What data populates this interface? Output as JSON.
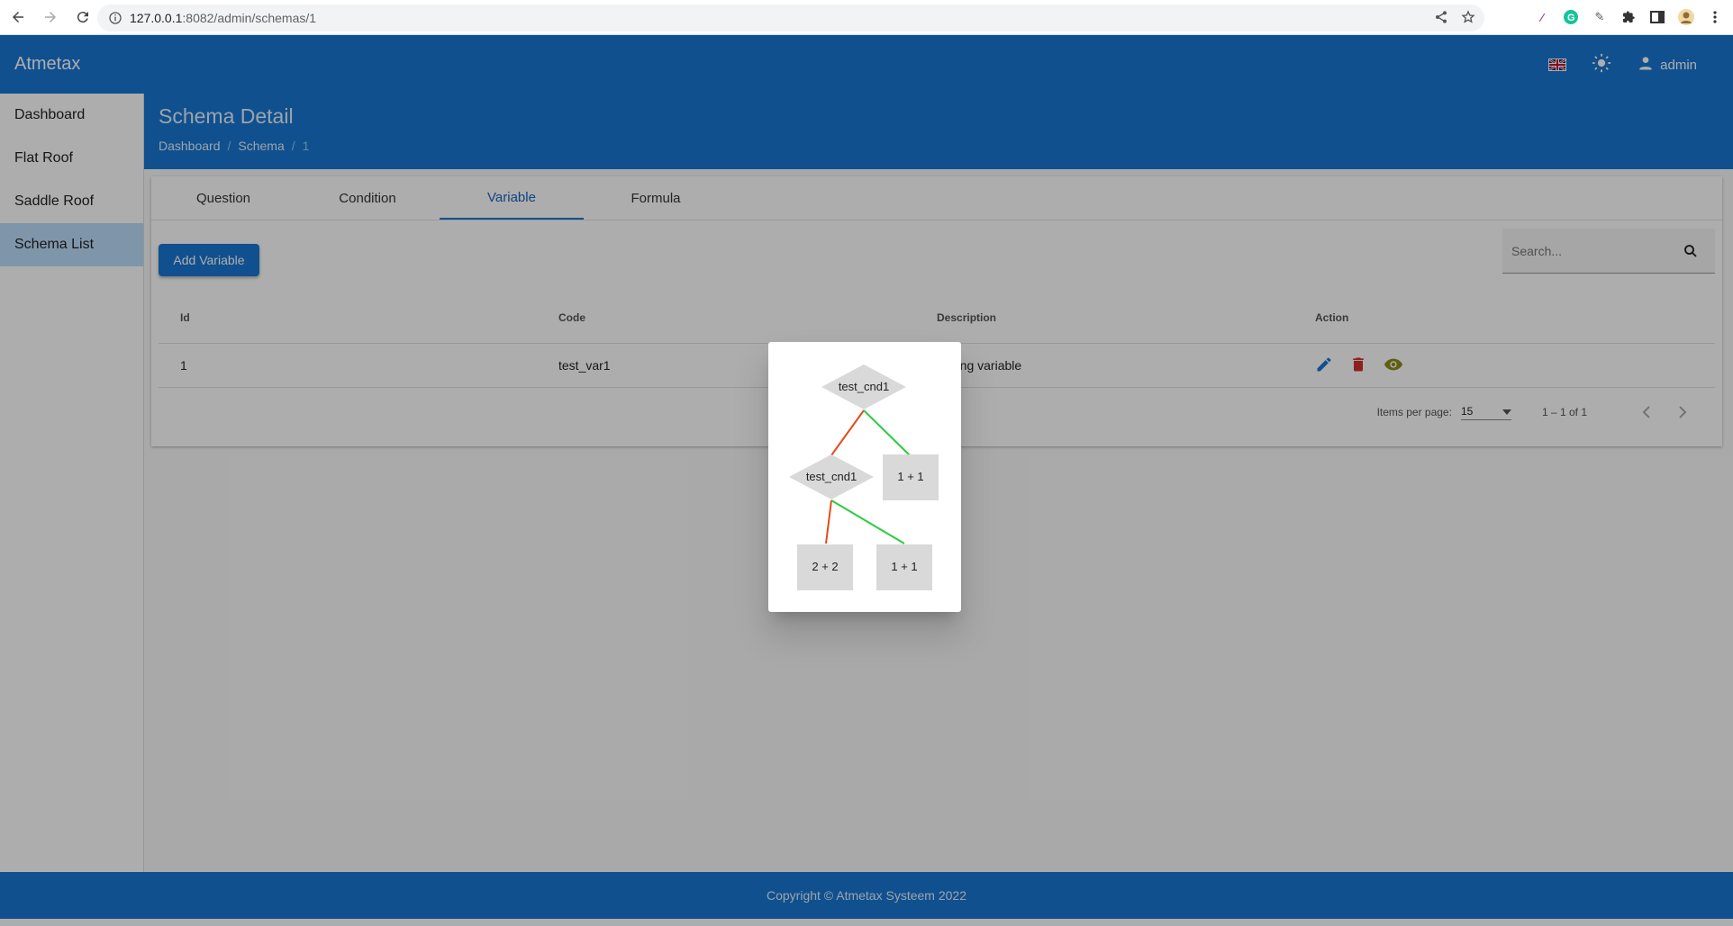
{
  "browser": {
    "url_host": "127.0.0.1",
    "url_path": ":8082/admin/schemas/1"
  },
  "app": {
    "brand": "Atmetax",
    "user": "admin"
  },
  "sidebar": {
    "items": [
      {
        "label": "Dashboard"
      },
      {
        "label": "Flat Roof"
      },
      {
        "label": "Saddle Roof"
      },
      {
        "label": "Schema List"
      }
    ]
  },
  "page": {
    "title": "Schema Detail",
    "breadcrumb": [
      "Dashboard",
      "Schema",
      "1"
    ]
  },
  "tabs": [
    {
      "label": "Question"
    },
    {
      "label": "Condition"
    },
    {
      "label": "Variable"
    },
    {
      "label": "Formula"
    }
  ],
  "toolbar": {
    "add_label": "Add Variable",
    "search_placeholder": "Search..."
  },
  "table": {
    "headers": [
      "Id",
      "Code",
      "Description",
      "Action"
    ],
    "rows": [
      {
        "id": "1",
        "code": "test_var1",
        "description": "testing variable"
      }
    ]
  },
  "paginator": {
    "label": "Items per page:",
    "page_size": "15",
    "range": "1 – 1 of 1"
  },
  "footer": {
    "text": "Copyright © Atmetax Systeem 2022"
  },
  "diagram": {
    "root": "test_cnd1",
    "child_condition": "test_cnd1",
    "leaf_right_top": "1 + 1",
    "leaf_bottom_left": "2 + 2",
    "leaf_bottom_right": "1 + 1",
    "colors": {
      "false_edge": "#e64a19",
      "true_edge": "#2ecc40",
      "node": "#d9d9d9"
    }
  },
  "colors": {
    "primary": "#1976d2",
    "edit": "#1976d2",
    "delete": "#d32f2f",
    "view": "#8c8c1a"
  }
}
